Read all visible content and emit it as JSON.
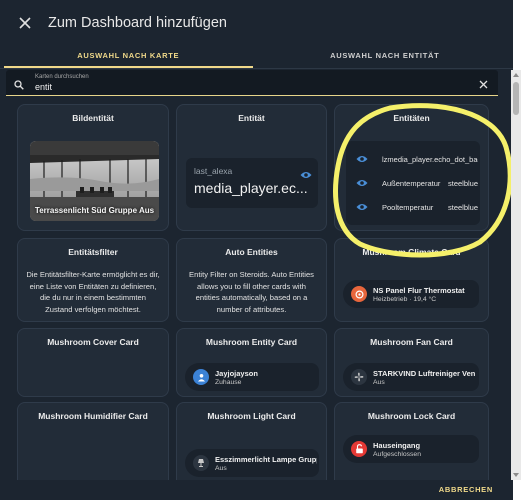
{
  "dialog": {
    "title": "Zum Dashboard hinzufügen",
    "close_icon": "close-icon",
    "tabs": [
      {
        "label": "AUSWAHL NACH KARTE",
        "active": true
      },
      {
        "label": "AUSWAHL NACH ENTITÄT",
        "active": false
      }
    ],
    "search": {
      "label": "Karten durchsuchen",
      "value": "entit",
      "icon": "search-icon",
      "clear_icon": "close-icon"
    },
    "apply_label": "ABBRECHEN"
  },
  "cards": {
    "bildentitaet": {
      "title": "Bildentität",
      "caption": "Terrassenlicht Süd Gruppe Aus"
    },
    "entitaet": {
      "title": "Entität",
      "name": "last_alexa",
      "state": "media_player.ec..."
    },
    "entitaeten": {
      "title": "Entitäten",
      "rows": [
        {
          "name": "lzmedia_player.echo_dot_badezimmer",
          "state": ""
        },
        {
          "name": "Außentemperatur",
          "state": "steelblue"
        },
        {
          "name": "Pooltemperatur",
          "state": "steelblue"
        }
      ]
    },
    "entitaetsfilter": {
      "title": "Entitätsfilter",
      "description": "Die Entitätsfilter-Karte ermöglicht es dir, eine Liste von Entitäten zu definieren, die du nur in einem bestimmten Zustand verfolgen möchtest."
    },
    "auto_entities": {
      "title": "Auto Entities",
      "description": "Entity Filter on Steroids. Auto Entities allows you to fill other cards with entities automatically, based on a number of attributes."
    },
    "mushroom_climate": {
      "title": "Mushroom Climate Card",
      "entity": "NS Panel Flur Thermostat",
      "state": "Heizbetrieb · 19,4 °C",
      "color": "#e8663c"
    },
    "mushroom_cover": {
      "title": "Mushroom Cover Card"
    },
    "mushroom_entity": {
      "title": "Mushroom Entity Card",
      "entity": "Jayjojayson",
      "state": "Zuhause",
      "color": "#3b82d6"
    },
    "mushroom_fan": {
      "title": "Mushroom Fan Card",
      "entity": "STARKVIND Luftreiniger Vent...",
      "state": "Aus",
      "color": "#5a6470"
    },
    "mushroom_humidifier": {
      "title": "Mushroom Humidifier Card"
    },
    "mushroom_light": {
      "title": "Mushroom Light Card",
      "entity": "Esszimmerlicht Lampe Grupp...",
      "state": "Aus",
      "color": "#5a6470"
    },
    "mushroom_lock": {
      "title": "Mushroom Lock Card",
      "entity": "Hauseingang",
      "state": "Aufgeschlossen",
      "color": "#e53935"
    }
  },
  "colors": {
    "accent": "#f0d98a",
    "background": "#1c2530",
    "card": "#222c38",
    "eye_icon": "#4a8fd8",
    "highlight_marker": "#f5f06a"
  }
}
